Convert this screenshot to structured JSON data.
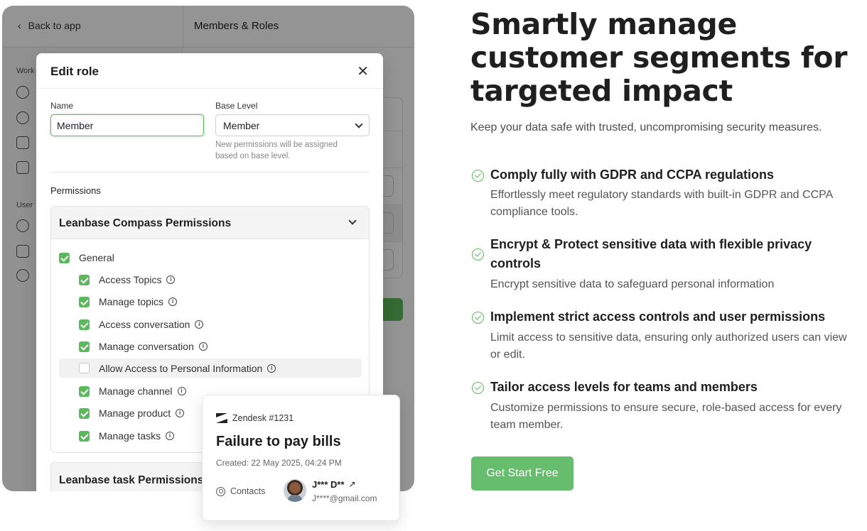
{
  "app": {
    "back_label": "Back to app",
    "section_title": "Members & Roles",
    "sidebar_sections": [
      "Work",
      "User"
    ]
  },
  "modal": {
    "title": "Edit role",
    "close_icon": "close-icon",
    "name_label": "Name",
    "name_value": "Member",
    "base_level_label": "Base Level",
    "base_level_value": "Member",
    "base_level_hint": "New permissions will be assigned based on base level.",
    "permissions_label": "Permissions",
    "group1_title": "Leanbase Compass Permissions",
    "group2_title": "Leanbase task Permissions",
    "items": [
      {
        "label": "General",
        "checked": true,
        "info": false
      },
      {
        "label": "Access Topics",
        "checked": true,
        "info": true
      },
      {
        "label": "Manage topics",
        "checked": true,
        "info": true
      },
      {
        "label": "Access conversation",
        "checked": true,
        "info": true
      },
      {
        "label": "Manage conversation",
        "checked": true,
        "info": true
      },
      {
        "label": "Allow Access to Personal Information",
        "checked": false,
        "info": true
      },
      {
        "label": "Manage channel",
        "checked": true,
        "info": true
      },
      {
        "label": "Manage product",
        "checked": true,
        "info": true
      },
      {
        "label": "Manage tasks",
        "checked": true,
        "info": true
      }
    ]
  },
  "ticket": {
    "source": "Zendesk #1231",
    "title": "Failure to pay bills",
    "created": "Created: 22 May 2025, 04:24 PM",
    "contacts_label": "Contacts",
    "contact_name": "J*** D**",
    "contact_email": "J****@gmail.com"
  },
  "hero": {
    "title": "Smartly manage customer segments for targeted impact",
    "subtitle": "Keep your data safe with trusted, uncompromising security measures.",
    "features": [
      {
        "title": "Comply fully with GDPR and CCPA regulations",
        "desc": "Effortlessly meet regulatory standards with built-in GDPR and CCPA compliance tools."
      },
      {
        "title": "Encrypt & Protect sensitive data with flexible privacy controls",
        "desc": "Encrypt sensitive data to safeguard personal information"
      },
      {
        "title": "Implement strict access controls and user permissions",
        "desc": "Limit access to sensitive data, ensuring only authorized users can view or edit."
      },
      {
        "title": "Tailor access levels for teams and members",
        "desc": "Customize permissions to ensure secure, role-based access for every team member."
      }
    ],
    "cta_label": "Get Start Free"
  },
  "colors": {
    "accent": "#5cb85c",
    "cta": "#66bd6d"
  }
}
